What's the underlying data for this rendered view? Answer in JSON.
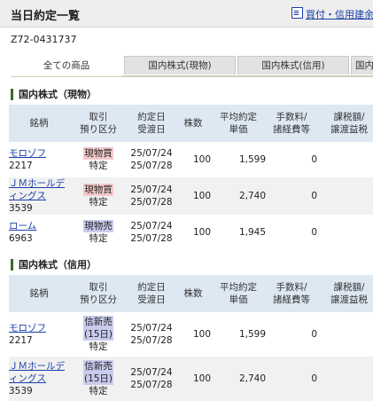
{
  "header": {
    "title": "当日約定一覧",
    "link_label": "買付・信用建余"
  },
  "account": "Z72-0431737",
  "tabs": [
    {
      "label": "全ての商品",
      "active": true
    },
    {
      "label": "国内株式(現物)",
      "active": false
    },
    {
      "label": "国内株式(信用)",
      "active": false
    },
    {
      "label": "国内",
      "active": false
    }
  ],
  "sections": [
    {
      "title": "国内株式（現物）",
      "headers": {
        "name": "銘柄",
        "type_1": "取引",
        "type_2": "預り区分",
        "date_1": "約定日",
        "date_2": "受渡日",
        "qty": "株数",
        "price_1": "平均約定",
        "price_2": "単価",
        "fee_1": "手数料/",
        "fee_2": "諸経費等",
        "tax_1": "課税額/",
        "tax_2": "譲渡益税"
      },
      "rows": [
        {
          "name": "モロゾフ",
          "code": "2217",
          "trade": "現物買",
          "custody": "特定",
          "exec": "25/07/24",
          "settle": "25/07/28",
          "qty": "100",
          "price": "1,599",
          "fee": "0",
          "tax": "--"
        },
        {
          "name": "ＪＭホールディングス",
          "code": "3539",
          "trade": "現物買",
          "custody": "特定",
          "exec": "25/07/24",
          "settle": "25/07/28",
          "qty": "100",
          "price": "2,740",
          "fee": "0",
          "tax": "--"
        },
        {
          "name": "ローム",
          "code": "6963",
          "trade": "現物売",
          "custody": "特定",
          "exec": "25/07/24",
          "settle": "25/07/28",
          "qty": "100",
          "price": "1,945",
          "fee": "0",
          "tax": "--"
        }
      ]
    },
    {
      "title": "国内株式（信用）",
      "headers": {
        "name": "銘柄",
        "type_1": "取引",
        "type_2": "預り区分",
        "date_1": "約定日",
        "date_2": "受渡日",
        "qty": "株数",
        "price_1": "平均約定",
        "price_2": "単価",
        "fee_1": "手数料/",
        "fee_2": "諸経費等",
        "tax_1": "課税額/",
        "tax_2": "譲渡益税"
      },
      "rows": [
        {
          "name": "モロゾフ",
          "code": "2217",
          "trade_1": "信新売",
          "trade_2": "(15日)",
          "custody": "特定",
          "exec": "25/07/24",
          "settle": "25/07/28",
          "qty": "100",
          "price": "1,599",
          "fee": "0",
          "tax": "--"
        },
        {
          "name": "ＪＭホールディングス",
          "code": "3539",
          "trade_1": "信新売",
          "trade_2": "(15日)",
          "custody": "特定",
          "exec": "25/07/24",
          "settle": "25/07/28",
          "qty": "100",
          "price": "2,740",
          "fee": "0",
          "tax": "--"
        }
      ]
    }
  ]
}
